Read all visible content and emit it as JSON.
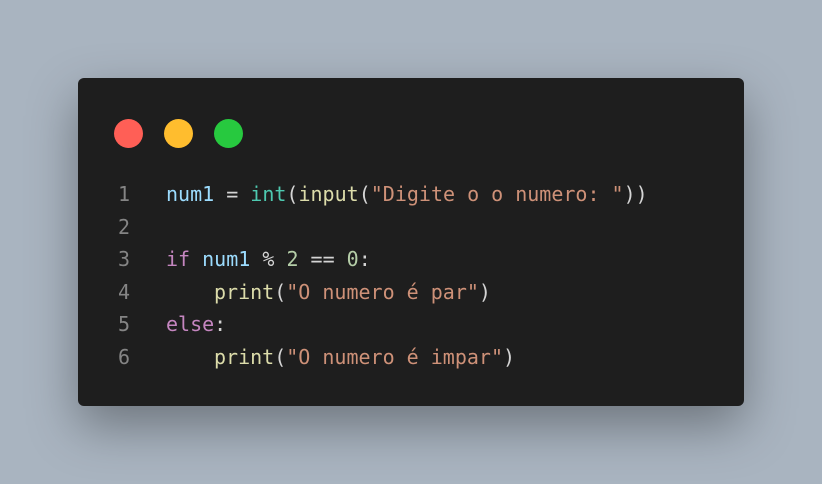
{
  "colors": {
    "background": "#a9b4c0",
    "window": "#1e1e1e",
    "dot_red": "#ff5f56",
    "dot_yellow": "#ffbd2e",
    "dot_green": "#27c93f",
    "variable": "#9cdcfe",
    "builtin": "#4ec9b0",
    "function": "#dcdcaa",
    "string": "#ce9178",
    "keyword": "#c586c0",
    "number": "#b5cea8",
    "default": "#d4d4d4",
    "line_number": "#858585"
  },
  "code": {
    "lines": [
      {
        "number": "1",
        "indent": false,
        "tokens": [
          {
            "text": "num1",
            "kind": "variable"
          },
          {
            "text": " = ",
            "kind": "default"
          },
          {
            "text": "int",
            "kind": "builtin"
          },
          {
            "text": "(",
            "kind": "default"
          },
          {
            "text": "input",
            "kind": "function"
          },
          {
            "text": "(",
            "kind": "default"
          },
          {
            "text": "\"Digite o o numero: \"",
            "kind": "string"
          },
          {
            "text": "))",
            "kind": "default"
          }
        ]
      },
      {
        "number": "2",
        "indent": false,
        "tokens": []
      },
      {
        "number": "3",
        "indent": false,
        "tokens": [
          {
            "text": "if",
            "kind": "keyword"
          },
          {
            "text": " ",
            "kind": "default"
          },
          {
            "text": "num1",
            "kind": "variable"
          },
          {
            "text": " % ",
            "kind": "default"
          },
          {
            "text": "2",
            "kind": "number"
          },
          {
            "text": " == ",
            "kind": "default"
          },
          {
            "text": "0",
            "kind": "number"
          },
          {
            "text": ":",
            "kind": "default"
          }
        ]
      },
      {
        "number": "4",
        "indent": true,
        "tokens": [
          {
            "text": "print",
            "kind": "function"
          },
          {
            "text": "(",
            "kind": "default"
          },
          {
            "text": "\"O numero é par\"",
            "kind": "string"
          },
          {
            "text": ")",
            "kind": "default"
          }
        ]
      },
      {
        "number": "5",
        "indent": false,
        "tokens": [
          {
            "text": "else",
            "kind": "keyword"
          },
          {
            "text": ":",
            "kind": "default"
          }
        ]
      },
      {
        "number": "6",
        "indent": true,
        "tokens": [
          {
            "text": "print",
            "kind": "function"
          },
          {
            "text": "(",
            "kind": "default"
          },
          {
            "text": "\"O numero é impar\"",
            "kind": "string"
          },
          {
            "text": ")",
            "kind": "default"
          }
        ]
      }
    ]
  }
}
